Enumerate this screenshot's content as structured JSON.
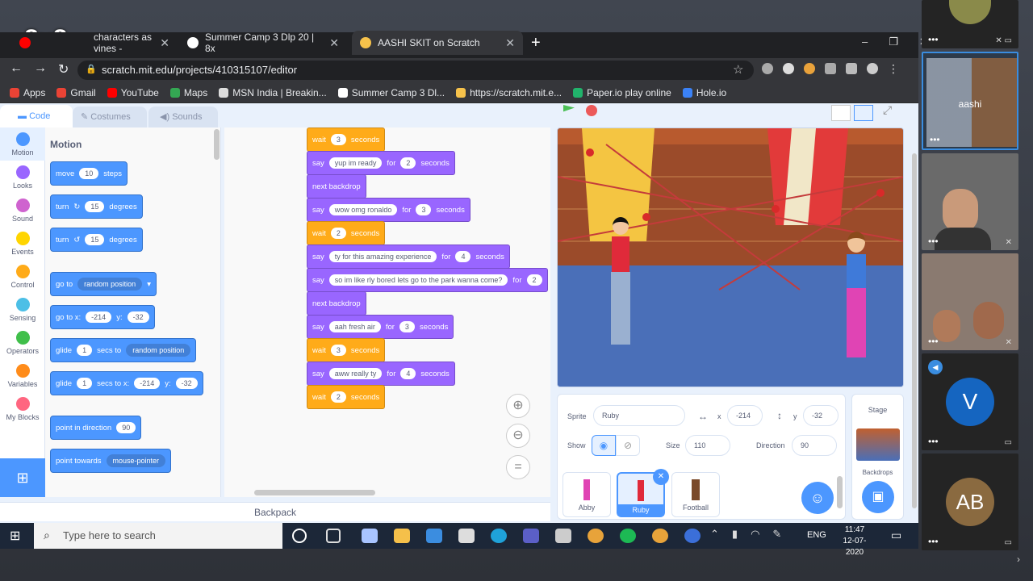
{
  "logo": "8x8",
  "browser": {
    "tabs": [
      {
        "label": "characters as vines -"
      },
      {
        "label": "Summer Camp 3 Dlp 20 | 8x"
      },
      {
        "label": "AASHI SKIT on Scratch"
      }
    ],
    "new_tab": "+",
    "url": "scratch.mit.edu/projects/410315107/editor",
    "bookmarks": [
      "Apps",
      "Gmail",
      "YouTube",
      "Maps",
      "MSN India | Breakin...",
      "Summer Camp 3 Dl...",
      "https://scratch.mit.e...",
      "Paper.io play online",
      "Hole.io"
    ],
    "window_controls": [
      "–",
      "❐",
      "✕"
    ]
  },
  "scratch": {
    "editor_tabs": [
      "Code",
      "Costumes",
      "Sounds"
    ],
    "categories": [
      {
        "label": "Motion",
        "color": "#4c97ff"
      },
      {
        "label": "Looks",
        "color": "#9966ff"
      },
      {
        "label": "Sound",
        "color": "#cf63cf"
      },
      {
        "label": "Events",
        "color": "#ffd500"
      },
      {
        "label": "Control",
        "color": "#ffab19"
      },
      {
        "label": "Sensing",
        "color": "#4cbfe6"
      },
      {
        "label": "Operators",
        "color": "#40bf4a"
      },
      {
        "label": "Variables",
        "color": "#ff8c1a"
      },
      {
        "label": "My Blocks",
        "color": "#ff6680"
      }
    ],
    "palette_title": "Motion",
    "palette": {
      "move": [
        "move",
        "10",
        "steps"
      ],
      "turn_right": [
        "turn",
        "15",
        "degrees"
      ],
      "turn_left": [
        "turn",
        "15",
        "degrees"
      ],
      "goto": [
        "go to",
        "random position"
      ],
      "gotoxy": [
        "go to x:",
        "-214",
        "y:",
        "-32"
      ],
      "glide1": [
        "glide",
        "1",
        "secs to",
        "random position"
      ],
      "glide2": [
        "glide",
        "1",
        "secs to x:",
        "-214",
        "y:",
        "-32"
      ],
      "point": [
        "point in direction",
        "90"
      ],
      "towards": [
        "point towards",
        "mouse-pointer"
      ]
    },
    "script": [
      {
        "kind": "ctrl",
        "a": "wait",
        "b": "3",
        "c": "seconds"
      },
      {
        "kind": "looks",
        "a": "say",
        "t": "yup im ready",
        "f": "for",
        "b": "2",
        "c": "seconds"
      },
      {
        "kind": "looks",
        "a": "next backdrop"
      },
      {
        "kind": "looks",
        "a": "say",
        "t": "wow omg ronaldo",
        "f": "for",
        "b": "3",
        "c": "seconds"
      },
      {
        "kind": "ctrl",
        "a": "wait",
        "b": "2",
        "c": "seconds"
      },
      {
        "kind": "looks",
        "a": "say",
        "t": "ty for this amazing experience",
        "f": "for",
        "b": "4",
        "c": "seconds"
      },
      {
        "kind": "looks",
        "a": "say",
        "t": "so im like rly bored lets go to the park wanna come?",
        "f": "for",
        "b": "2",
        "c": ""
      },
      {
        "kind": "looks",
        "a": "next backdrop"
      },
      {
        "kind": "looks",
        "a": "say",
        "t": "aah fresh air",
        "f": "for",
        "b": "3",
        "c": "seconds"
      },
      {
        "kind": "ctrl",
        "a": "wait",
        "b": "3",
        "c": "seconds"
      },
      {
        "kind": "looks",
        "a": "say",
        "t": "aww really ty",
        "f": "for",
        "b": "4",
        "c": "seconds"
      },
      {
        "kind": "ctrl",
        "a": "wait",
        "b": "2",
        "c": "seconds"
      }
    ],
    "backpack": "Backpack",
    "sprite": {
      "label": "Sprite",
      "name": "Ruby",
      "x_label": "x",
      "x": "-214",
      "y_label": "y",
      "y": "-32",
      "show_label": "Show",
      "size_label": "Size",
      "size": "110",
      "direction_label": "Direction",
      "direction": "90"
    },
    "sprites": [
      "Abby",
      "Ruby",
      "Football"
    ],
    "stage": {
      "label": "Stage",
      "backdrops": "Backdrops"
    }
  },
  "taskbar": {
    "search": "Type here to search",
    "time": "11:47",
    "date": "12-07-2020",
    "lang": "ENG"
  },
  "meeting": {
    "participant_label": "aashi",
    "tiles": [
      {
        "initial": "V",
        "color": "#1565c0"
      },
      {
        "initial": "AB",
        "color": "#8a6a40"
      }
    ]
  }
}
